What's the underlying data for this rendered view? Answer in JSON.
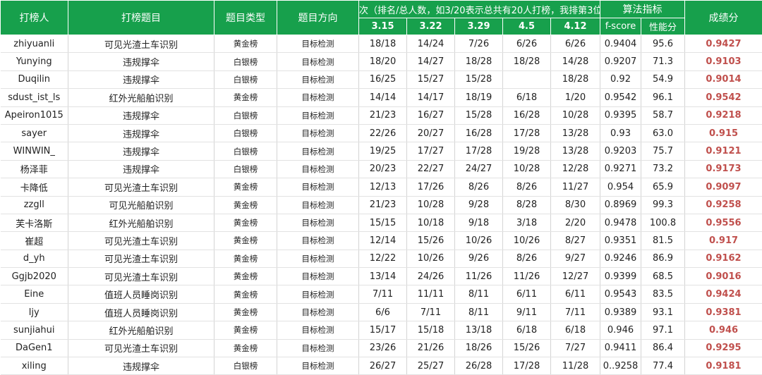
{
  "headers": {
    "player": "打榜人",
    "topic": "打榜题目",
    "type": "题目类型",
    "direction": "题目方向",
    "rank_group": "次（排名/总人数，如3/20表示总共有20人打榜，我排第3位",
    "algo_group": "算法指标",
    "score": "成绩分",
    "dates": [
      "3.15",
      "3.22",
      "3.29",
      "4.5",
      "4.12"
    ],
    "fscore": "f-score",
    "perf": "性能分"
  },
  "rows": [
    {
      "player": "zhiyuanli",
      "topic": "可见光渣土车识别",
      "type": "黄金榜",
      "direction": "目标检测",
      "ranks": [
        "18/18",
        "14/24",
        "7/26",
        "6/26",
        "6/26"
      ],
      "fscore": "0.9404",
      "perf": "95.6",
      "score": "0.9427"
    },
    {
      "player": "Yunying",
      "topic": "违规撑伞",
      "type": "白银榜",
      "direction": "目标检测",
      "ranks": [
        "18/20",
        "14/27",
        "18/28",
        "18/28",
        "14/28"
      ],
      "fscore": "0.9207",
      "perf": "71.3",
      "score": "0.9103"
    },
    {
      "player": "Duqilin",
      "topic": "违规撑伞",
      "type": "白银榜",
      "direction": "目标检测",
      "ranks": [
        "16/25",
        "15/27",
        "15/28",
        "",
        "18/28"
      ],
      "fscore": "0.92",
      "perf": "54.9",
      "score": "0.9014"
    },
    {
      "player": "sdust_ist_ls",
      "topic": "红外光船舶识别",
      "type": "黄金榜",
      "direction": "目标检测",
      "ranks": [
        "14/14",
        "14/17",
        "18/19",
        "6/18",
        "1/20"
      ],
      "fscore": "0.9542",
      "perf": "96.1",
      "score": "0.9542"
    },
    {
      "player": "Apeiron1015",
      "topic": "违规撑伞",
      "type": "白银榜",
      "direction": "目标检测",
      "ranks": [
        "21/23",
        "16/27",
        "15/28",
        "16/28",
        "10/28"
      ],
      "fscore": "0.9395",
      "perf": "58.7",
      "score": "0.9218"
    },
    {
      "player": "sayer",
      "topic": "违规撑伞",
      "type": "白银榜",
      "direction": "目标检测",
      "ranks": [
        "22/26",
        "20/27",
        "16/28",
        "17/28",
        "13/28"
      ],
      "fscore": "0.93",
      "perf": "63.0",
      "score": "0.915"
    },
    {
      "player": "WINWIN_",
      "topic": "违规撑伞",
      "type": "白银榜",
      "direction": "目标检测",
      "ranks": [
        "19/25",
        "17/27",
        "17/28",
        "19/28",
        "13/28"
      ],
      "fscore": "0.9203",
      "perf": "75.7",
      "score": "0.9121"
    },
    {
      "player": "杨泽菲",
      "topic": "违规撑伞",
      "type": "白银榜",
      "direction": "目标检测",
      "ranks": [
        "20/23",
        "22/27",
        "24/27",
        "10/28",
        "12/28"
      ],
      "fscore": "0.9271",
      "perf": "73.2",
      "score": "0.9173"
    },
    {
      "player": "卡降低",
      "topic": "可见光渣土车识别",
      "type": "黄金榜",
      "direction": "目标检测",
      "ranks": [
        "12/13",
        "17/26",
        "8/26",
        "8/26",
        "11/27"
      ],
      "fscore": "0.954",
      "perf": "65.9",
      "score": "0.9097"
    },
    {
      "player": "zzgll",
      "topic": "可见光船舶识别",
      "type": "黄金榜",
      "direction": "目标检测",
      "ranks": [
        "21/23",
        "10/28",
        "9/28",
        "8/28",
        "8/30"
      ],
      "fscore": "0.8969",
      "perf": "99.3",
      "score": "0.9258"
    },
    {
      "player": "芙卡洛斯",
      "topic": "红外光船舶识别",
      "type": "黄金榜",
      "direction": "目标检测",
      "ranks": [
        "15/15",
        "10/18",
        "9/18",
        "3/18",
        "2/20"
      ],
      "fscore": "0.9478",
      "perf": "100.8",
      "score": "0.9556"
    },
    {
      "player": "崔超",
      "topic": "可见光渣土车识别",
      "type": "黄金榜",
      "direction": "目标检测",
      "ranks": [
        "12/14",
        "15/26",
        "10/26",
        "10/26",
        "8/27"
      ],
      "fscore": "0.9351",
      "perf": "81.5",
      "score": "0.917"
    },
    {
      "player": "d_yh",
      "topic": "可见光渣土车识别",
      "type": "黄金榜",
      "direction": "目标检测",
      "ranks": [
        "12/22",
        "10/26",
        "9/26",
        "8/26",
        "9/27"
      ],
      "fscore": "0.9246",
      "perf": "86.9",
      "score": "0.9162"
    },
    {
      "player": "Ggjb2020",
      "topic": "可见光渣土车识别",
      "type": "黄金榜",
      "direction": "目标检测",
      "ranks": [
        "13/14",
        "24/26",
        "11/26",
        "11/26",
        "12/27"
      ],
      "fscore": "0.9399",
      "perf": "68.5",
      "score": "0.9016"
    },
    {
      "player": "Eine",
      "topic": "值班人员睡岗识别",
      "type": "黄金榜",
      "direction": "目标检测",
      "ranks": [
        "7/11",
        "11/11",
        "8/11",
        "6/11",
        "6/11"
      ],
      "fscore": "0.9543",
      "perf": "83.5",
      "score": "0.9424"
    },
    {
      "player": "ljy",
      "topic": "值班人员睡岗识别",
      "type": "黄金榜",
      "direction": "目标检测",
      "ranks": [
        "6/6",
        "7/11",
        "8/11",
        "9/11",
        "7/11"
      ],
      "fscore": "0.9389",
      "perf": "93.1",
      "score": "0.9381"
    },
    {
      "player": "sunjiahui",
      "topic": "红外光船舶识别",
      "type": "黄金榜",
      "direction": "目标检测",
      "ranks": [
        "15/17",
        "15/18",
        "13/18",
        "6/18",
        "6/18"
      ],
      "fscore": "0.946",
      "perf": "97.1",
      "score": "0.946"
    },
    {
      "player": "DaGen1",
      "topic": "可见光渣土车识别",
      "type": "黄金榜",
      "direction": "目标检测",
      "ranks": [
        "23/26",
        "21/26",
        "18/26",
        "15/26",
        "7/27"
      ],
      "fscore": "0.9411",
      "perf": "86.4",
      "score": "0.9295"
    },
    {
      "player": "xiling",
      "topic": "违规撑伞",
      "type": "白银榜",
      "direction": "目标检测",
      "ranks": [
        "26/27",
        "25/27",
        "26/28",
        "17/28",
        "11/28"
      ],
      "fscore": "0..9258",
      "perf": "77.4",
      "score": "0.9181"
    }
  ],
  "colors": {
    "header_bg": "#17a04c",
    "header_text": "#ffffff",
    "score_text": "#c0504d"
  }
}
